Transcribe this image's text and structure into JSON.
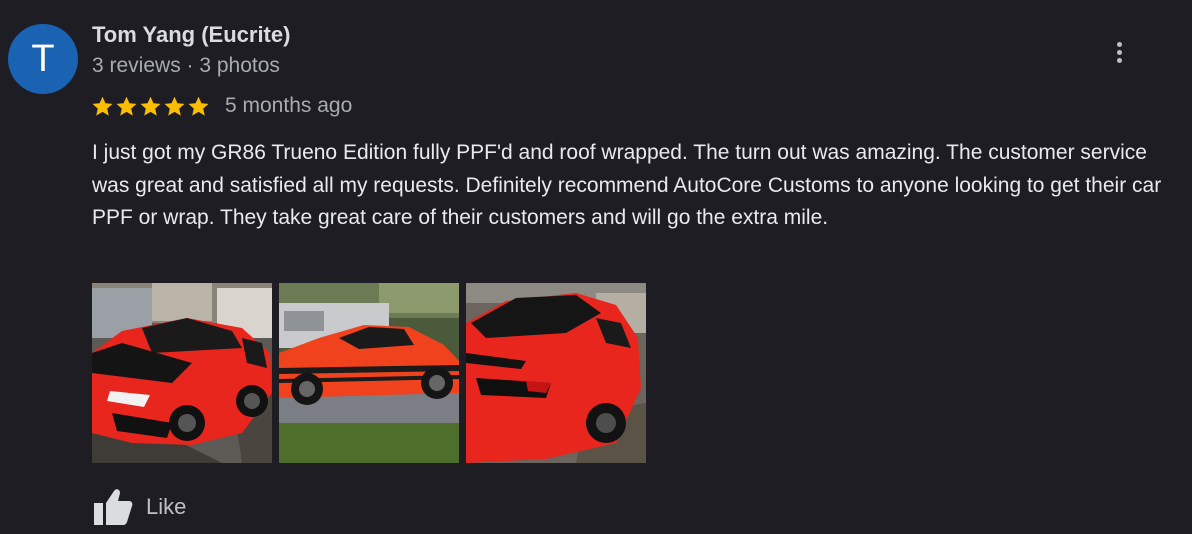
{
  "author": {
    "initial": "T",
    "name": "Tom Yang (Eucrite)",
    "meta": "3 reviews · 3 photos",
    "avatar_color": "#1a63b3"
  },
  "review": {
    "rating": 5,
    "max_rating": 5,
    "time": "5 months ago",
    "text": "I just got my GR86 Trueno Edition fully PPF'd and roof wrapped. The turn out was amazing. The customer service was great and satisfied all my requests. Definitely recommend AutoCore Customs to anyone looking to get their car PPF or wrap. They take great care of their customers and will go the extra mile."
  },
  "photos": [
    {
      "icon": "car-front-photo"
    },
    {
      "icon": "car-side-photo"
    },
    {
      "icon": "car-rear-photo"
    }
  ],
  "actions": {
    "like_label": "Like",
    "more_icon": "more-vert-icon"
  },
  "colors": {
    "background": "#1e1d24",
    "star": "#fbbc04",
    "car_red": "#e8261e",
    "text_primary": "#e8eaed",
    "text_secondary": "#a8abb0"
  }
}
